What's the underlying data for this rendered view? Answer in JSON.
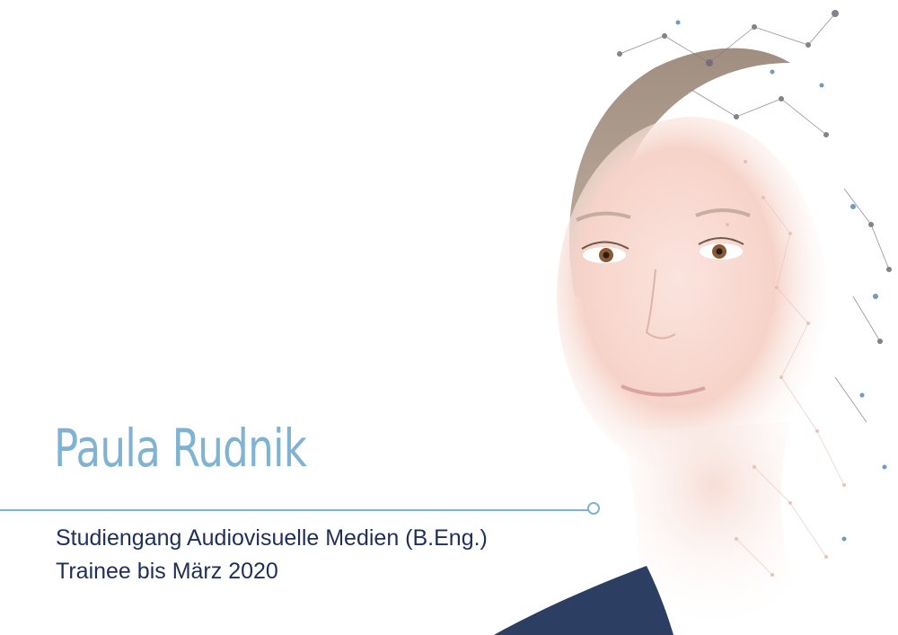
{
  "profile": {
    "name": "Paula Rudnik",
    "program": "Studiengang Audiovisuelle Medien (B.Eng.)",
    "role": "Trainee bis März 2020"
  },
  "colors": {
    "accent": "#7fb3d1",
    "text_dark": "#1f2f57",
    "background": "#ffffff"
  }
}
